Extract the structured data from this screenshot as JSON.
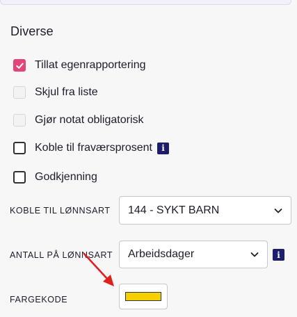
{
  "section": {
    "title": "Diverse"
  },
  "checkboxes": [
    {
      "label": "Tillat egenrapportering",
      "state": "checked"
    },
    {
      "label": "Skjul fra liste",
      "state": "disabled"
    },
    {
      "label": "Gjør notat obligatorisk",
      "state": "disabled"
    },
    {
      "label": "Koble til fraværsprosent",
      "state": "unchecked",
      "info_icon": "info-icon"
    },
    {
      "label": "Godkjenning",
      "state": "unchecked"
    }
  ],
  "fields": {
    "lonnsart": {
      "label": "KOBLE TIL LØNNSART",
      "value": "144 - SYKT BARN"
    },
    "antall": {
      "label": "ANTALL PÅ LØNNSART",
      "value": "Arbeidsdager",
      "info_icon": "info-icon"
    },
    "fargekode": {
      "label": "FARGEKODE",
      "color": "#f5d000"
    }
  },
  "info_glyph": "i",
  "annotation": {
    "type": "red-arrow",
    "color": "#e0201e",
    "points_to": "fargekode-swatch"
  },
  "colors": {
    "accent": "#e2457a",
    "info": "#1d1d6b"
  }
}
